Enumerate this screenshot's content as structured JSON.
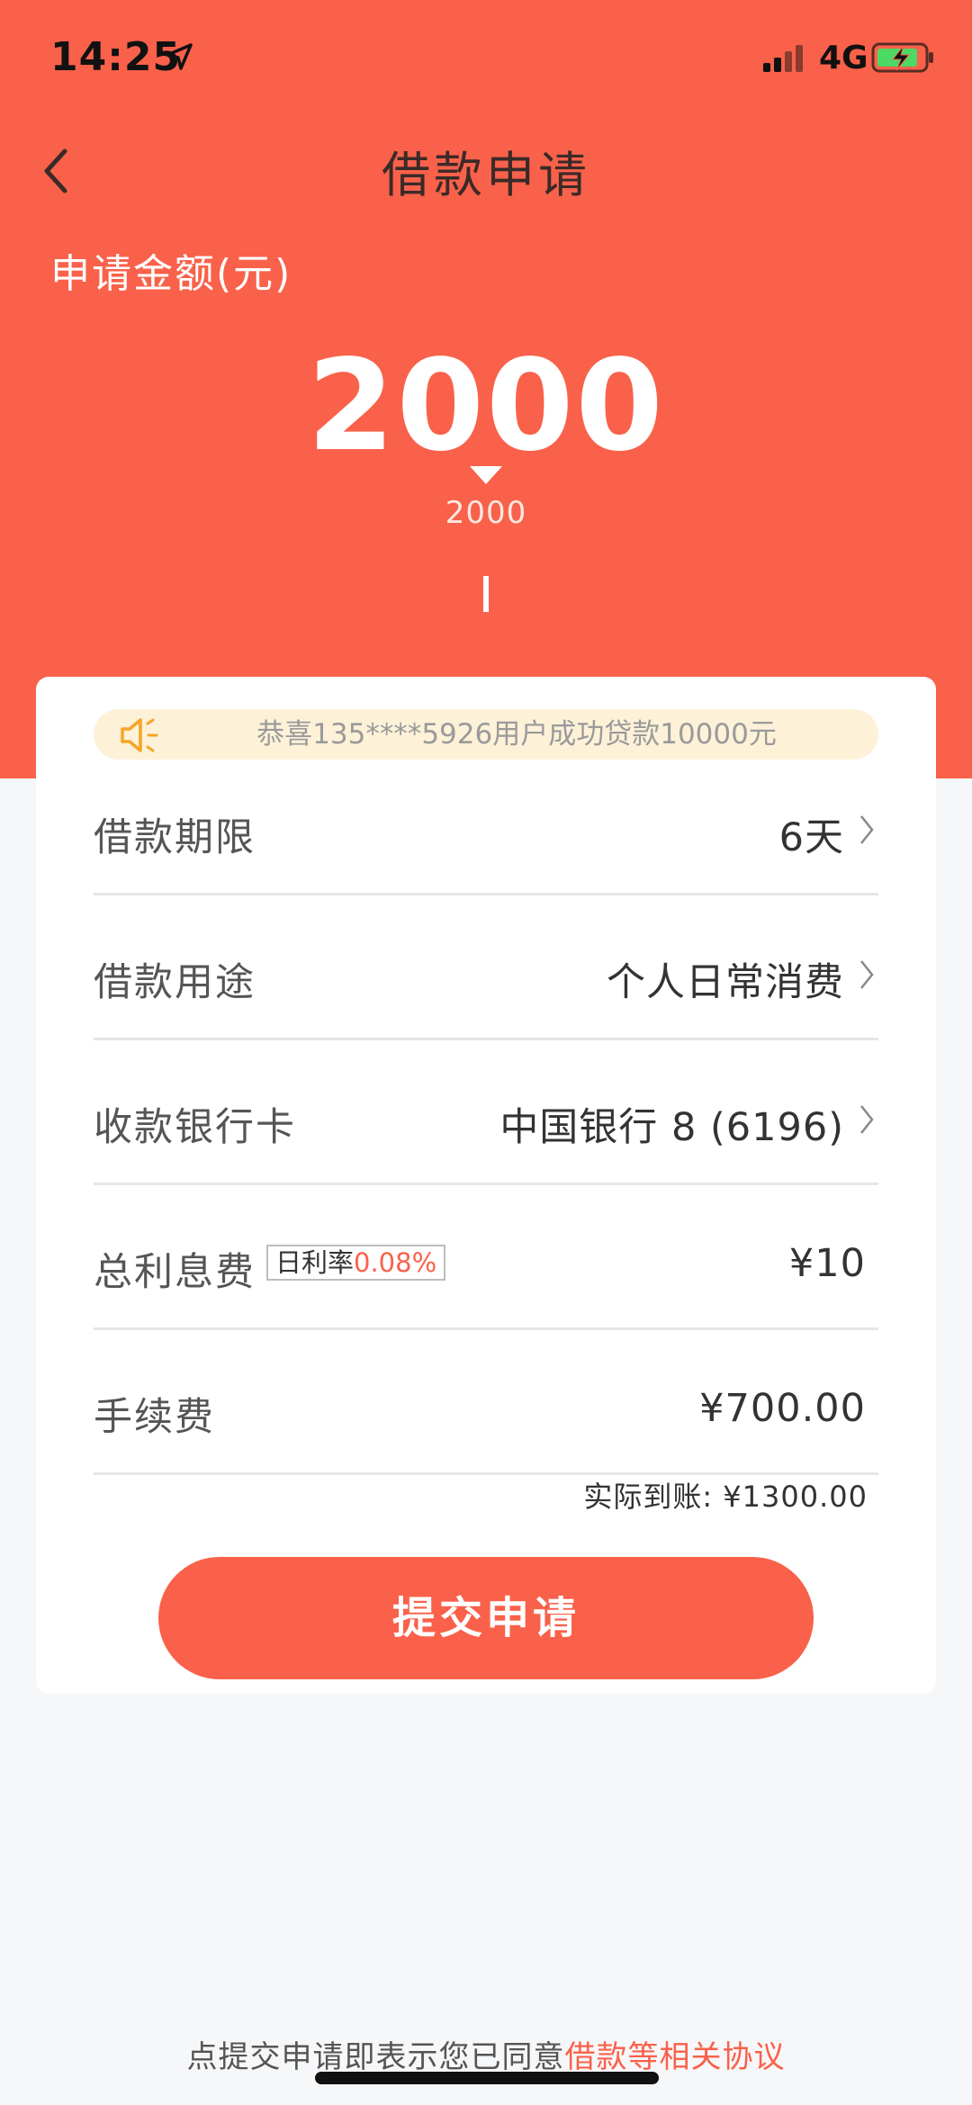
{
  "status_bar": {
    "time": "14:25",
    "network": "4G"
  },
  "nav": {
    "title": "借款申请"
  },
  "amount": {
    "label": "申请金额(元)",
    "value": "2000",
    "slider_value": "2000"
  },
  "notice": {
    "text": "恭喜135****5926用户成功贷款10000元"
  },
  "rows": [
    {
      "label": "借款期限",
      "value": "6天"
    },
    {
      "label": "借款用途",
      "value": "个人日常消费"
    },
    {
      "label": "收款银行卡",
      "value": "中国银行 8 (6196)"
    },
    {
      "label": "总利息费",
      "value": "¥10",
      "badge_prefix": "日利率",
      "badge_rate": "0.08%"
    },
    {
      "label": "手续费",
      "value": "¥700.00"
    }
  ],
  "received": "实际到账: ¥1300.00",
  "submit_label": "提交申请",
  "agreement": {
    "prefix": "点提交申请即表示您已同意",
    "link": "借款等相关协议"
  },
  "colors": {
    "accent": "#f9614a",
    "notice_bg": "#fdf1d8",
    "speaker": "#f5a623"
  }
}
